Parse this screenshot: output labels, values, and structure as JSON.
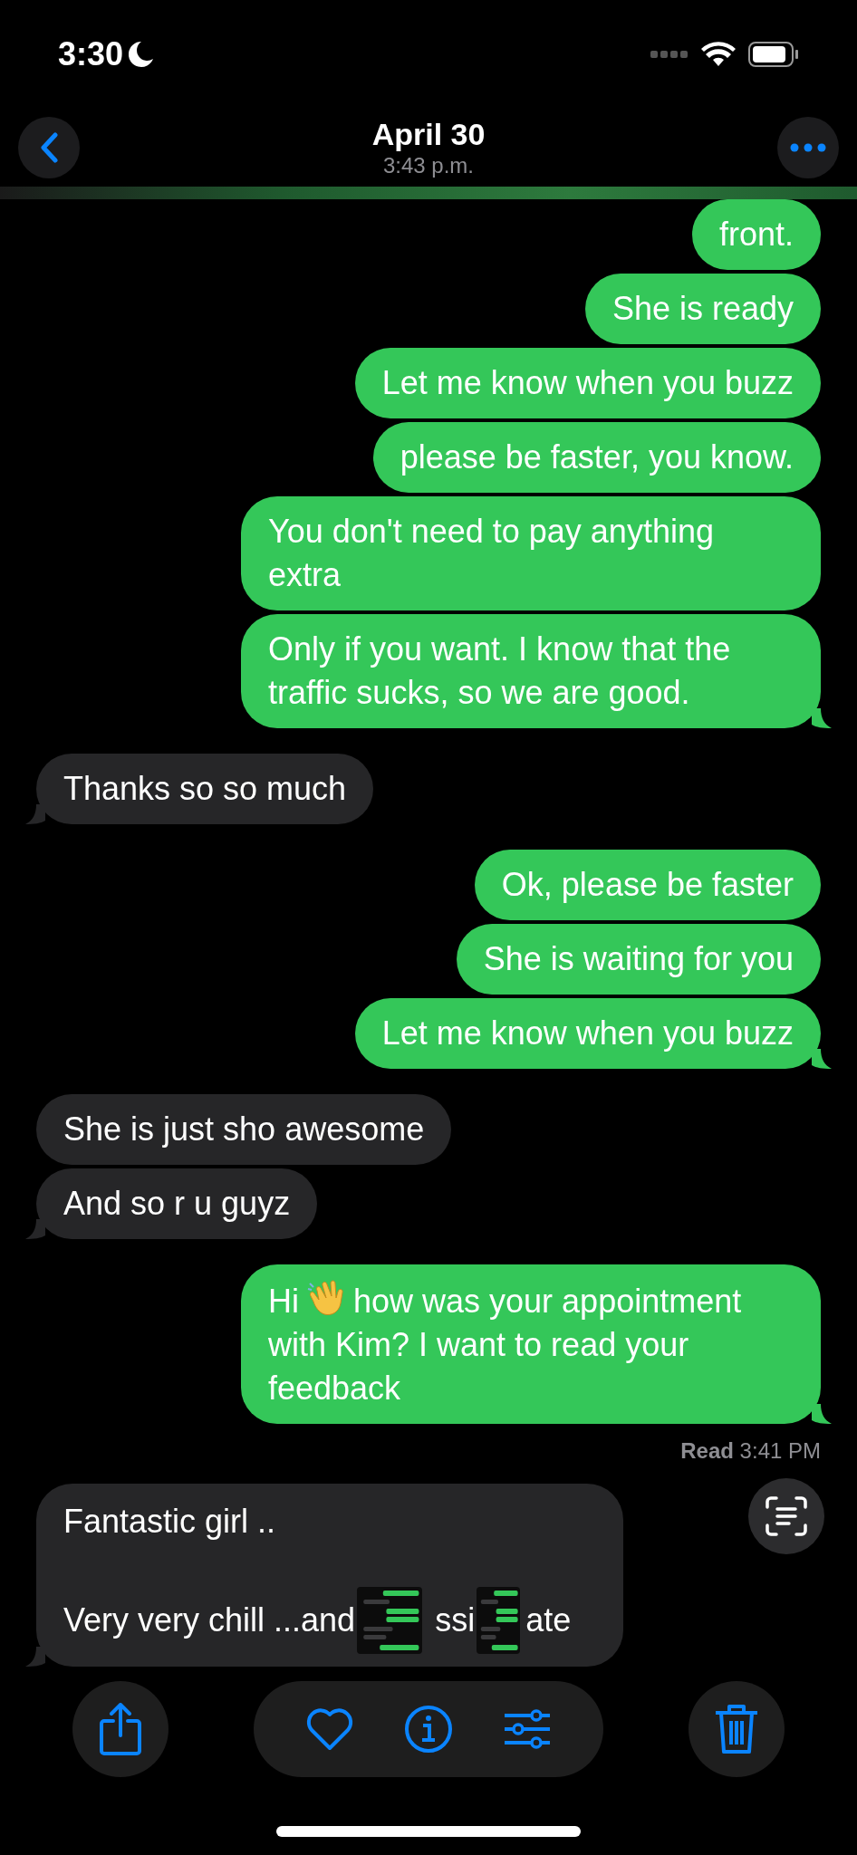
{
  "status_bar": {
    "time": "3:30"
  },
  "header": {
    "title": "April 30",
    "subtitle": "3:43 p.m."
  },
  "messages": [
    {
      "outgoing": true,
      "kind": "text",
      "text": "front.",
      "tail": false
    },
    {
      "outgoing": true,
      "kind": "text",
      "text": "She is ready",
      "tail": false
    },
    {
      "outgoing": true,
      "kind": "text",
      "text": "Let me know when you buzz",
      "tail": false
    },
    {
      "outgoing": true,
      "kind": "text",
      "text": "please be faster, you know.",
      "tail": false
    },
    {
      "outgoing": true,
      "kind": "text",
      "text": "You don't need to pay anything extra",
      "tail": false
    },
    {
      "outgoing": true,
      "kind": "text",
      "text": "Only if you want. I know that the traffic sucks, so we are good.",
      "tail": true
    },
    {
      "outgoing": false,
      "kind": "text",
      "text": "Thanks so so much",
      "tail": true
    },
    {
      "outgoing": true,
      "kind": "text",
      "text": "Ok, please be faster",
      "tail": false
    },
    {
      "outgoing": true,
      "kind": "text",
      "text": "She is waiting for you",
      "tail": false
    },
    {
      "outgoing": true,
      "kind": "text",
      "text": "Let me know when you buzz",
      "tail": true
    },
    {
      "outgoing": false,
      "kind": "text",
      "text": "She is just sho awesome",
      "tail": false
    },
    {
      "outgoing": false,
      "kind": "text",
      "text": "And so r u guyz",
      "tail": true
    },
    {
      "outgoing": true,
      "kind": "wave",
      "before": "Hi",
      "text": "how was your appointment with Kim? I want to read your feedback",
      "tail": true
    }
  ],
  "read_receipt": {
    "label": "Read",
    "time": "3:41 PM"
  },
  "last_message": {
    "line1": "Fantastic girl ..",
    "line2_parts": [
      "Very very chill ...and",
      "ssi",
      "ate"
    ]
  }
}
